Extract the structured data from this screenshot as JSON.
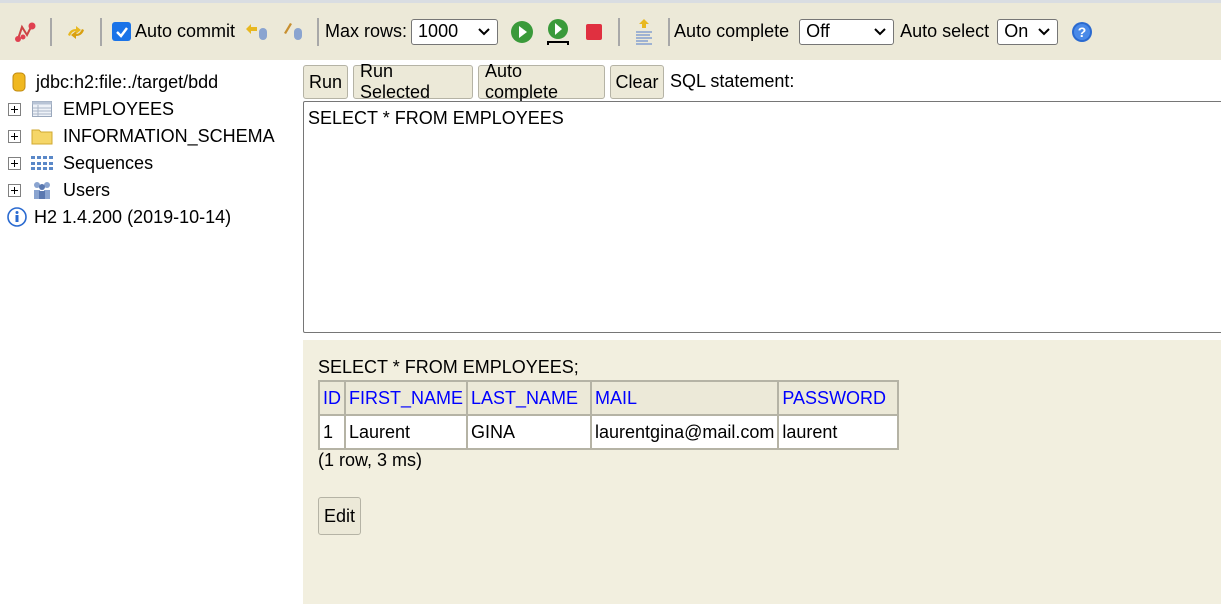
{
  "toolbar": {
    "icons": {
      "disconnect": "disconnect-icon",
      "refresh": "refresh-icon",
      "rollback": "rollback-icon",
      "commit": "commit-icon",
      "run": "run-icon",
      "run_selected": "run-selected-icon",
      "stop": "stop-icon",
      "history": "history-icon",
      "help": "help-icon"
    },
    "auto_commit_label": "Auto commit",
    "auto_commit_checked": true,
    "max_rows_label": "Max rows:",
    "max_rows_value": "1000",
    "auto_complete_label": "Auto complete",
    "auto_complete_value": "Off",
    "auto_select_label": "Auto select",
    "auto_select_value": "On",
    "help_glyph": "?"
  },
  "sidebar": {
    "connection": "jdbc:h2:file:./target/bdd",
    "items": [
      {
        "label": "EMPLOYEES",
        "icon": "table-icon"
      },
      {
        "label": "INFORMATION_SCHEMA",
        "icon": "folder-icon"
      },
      {
        "label": "Sequences",
        "icon": "sequences-icon"
      },
      {
        "label": "Users",
        "icon": "users-icon"
      }
    ],
    "version": "H2 1.4.200 (2019-10-14)"
  },
  "editor": {
    "buttons": {
      "run": "Run",
      "run_selected": "Run Selected",
      "auto_complete": "Auto complete",
      "clear": "Clear"
    },
    "sql_label": "SQL statement:",
    "sql_text": "SELECT * FROM EMPLOYEES"
  },
  "result": {
    "query": "SELECT * FROM EMPLOYEES;",
    "columns": [
      "ID",
      "FIRST_NAME",
      "LAST_NAME",
      "MAIL",
      "PASSWORD"
    ],
    "rows": [
      [
        "1",
        "Laurent",
        "GINA",
        "laurentgina@mail.com",
        "laurent"
      ]
    ],
    "status": "(1 row, 3 ms)",
    "edit_label": "Edit"
  },
  "colors": {
    "toolbar_bg": "#ece9d8",
    "result_bg": "#f2efdf",
    "header_link": "#0000ff",
    "checkbox": "#1a73e8"
  }
}
